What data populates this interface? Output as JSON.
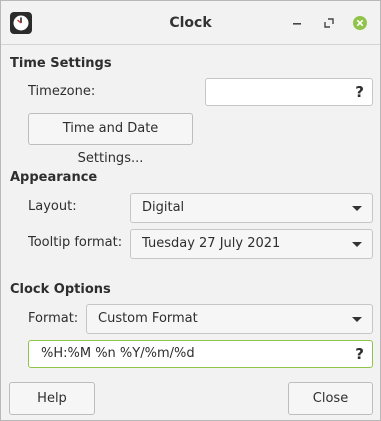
{
  "window": {
    "title": "Clock",
    "app_icon": "clock-icon",
    "controls": [
      "minimize-icon",
      "restore-icon",
      "close-icon"
    ],
    "close_color": "#8fc34a"
  },
  "time_settings": {
    "heading": "Time Settings",
    "timezone_label": "Timezone:",
    "timezone_value": "",
    "timezone_help": "?",
    "time_date_button": "Time and Date Settings..."
  },
  "appearance": {
    "heading": "Appearance",
    "layout_label": "Layout:",
    "layout_value": "Digital",
    "tooltip_label": "Tooltip format:",
    "tooltip_value": "Tuesday 27 July 2021"
  },
  "clock_options": {
    "heading": "Clock Options",
    "format_label": "Format:",
    "format_value": "Custom Format",
    "custom_format_value": "%H:%M %n %Y/%m/%d",
    "custom_format_help": "?"
  },
  "footer": {
    "help_label": "Help",
    "close_label": "Close"
  }
}
